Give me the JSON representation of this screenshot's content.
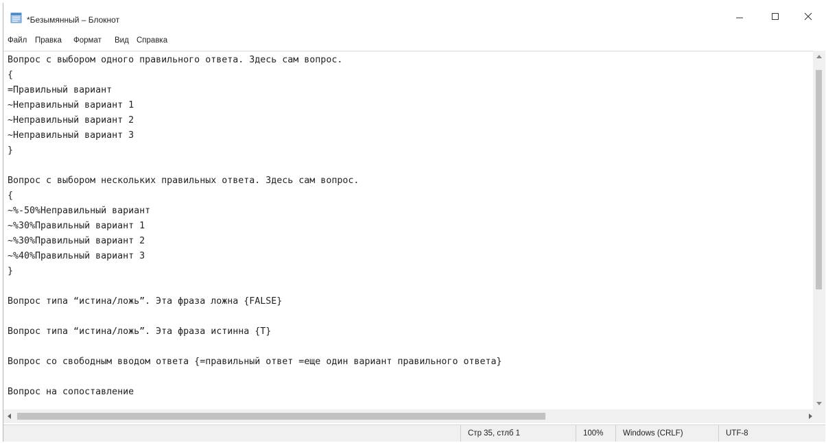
{
  "window": {
    "title": "*Безымянный – Блокнот",
    "minimize_symbol": "–",
    "maximize_symbol": "☐",
    "close_symbol": "✕"
  },
  "menu": {
    "items": [
      "Файл",
      "Правка",
      "Формат",
      "Вид",
      "Справка"
    ]
  },
  "editor": {
    "lines": [
      "Вопрос с выбором одного правильного ответа. Здесь сам вопрос.",
      "{",
      "=Правильный вариант",
      "~Неправильный вариант 1",
      "~Неправильный вариант 2",
      "~Неправильный вариант 3",
      "}",
      "",
      "Вопрос с выбором нескольких правильных ответа. Здесь сам вопрос.",
      "{",
      "~%-50%Неправильный вариант",
      "~%30%Правильный вариант 1",
      "~%30%Правильный вариант 2",
      "~%40%Правильный вариант 3",
      "}",
      "",
      "Вопрос типа “истина/ложь”. Эта фраза ложна {FALSE}",
      "",
      "Вопрос типа “истина/ложь”. Эта фраза истинна {T}",
      "",
      "Вопрос со свободным вводом ответа {=правильный ответ =еще один вариант правильного ответа}",
      "",
      "Вопрос на сопоставление"
    ]
  },
  "status": {
    "position": "Стр 35, стлб 1",
    "zoom": "100%",
    "line_ending": "Windows (CRLF)",
    "encoding": "UTF-8"
  }
}
